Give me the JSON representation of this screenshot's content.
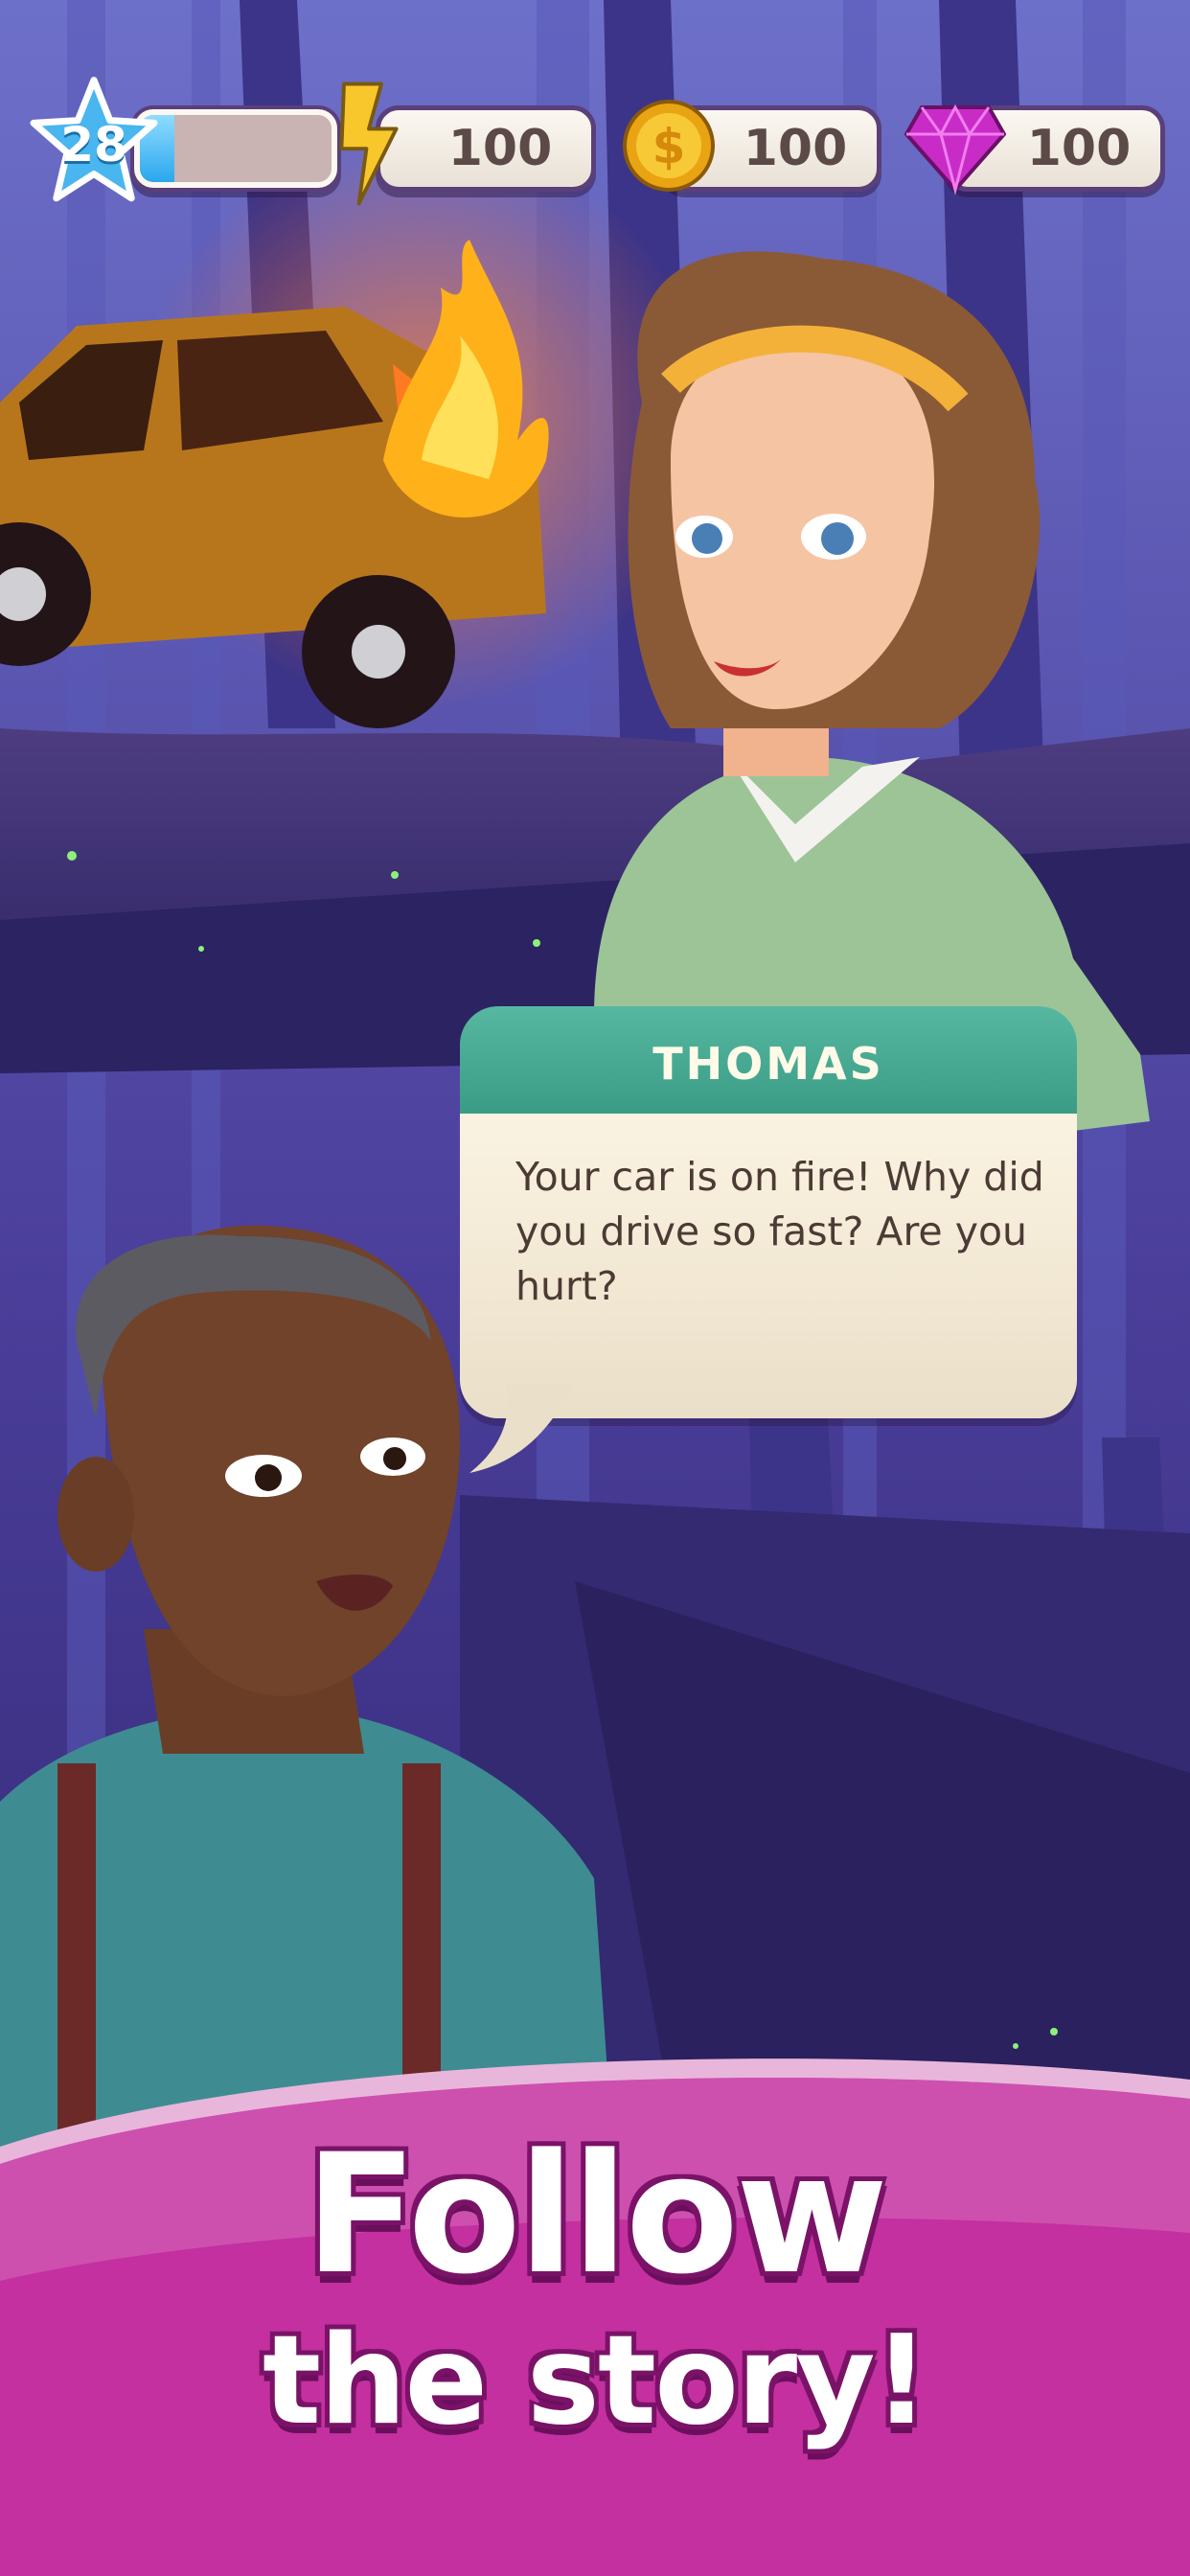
{
  "hud": {
    "level": "28",
    "xp_progress": 0.18,
    "energy": {
      "icon": "lightning-icon",
      "value": "100"
    },
    "coins": {
      "icon": "coin-icon",
      "value": "100"
    },
    "gems": {
      "icon": "gem-icon",
      "value": "100"
    }
  },
  "dialogue": {
    "speaker": "THOMAS",
    "text": "Your car is on fire! Why did you drive so fast? Are you hurt?"
  },
  "banner": {
    "line1": "Follow",
    "line2": "the story!"
  },
  "colors": {
    "banner_pink": "#c4309f",
    "speaker_teal": "#45a891",
    "night_purple": "#2a2266"
  }
}
